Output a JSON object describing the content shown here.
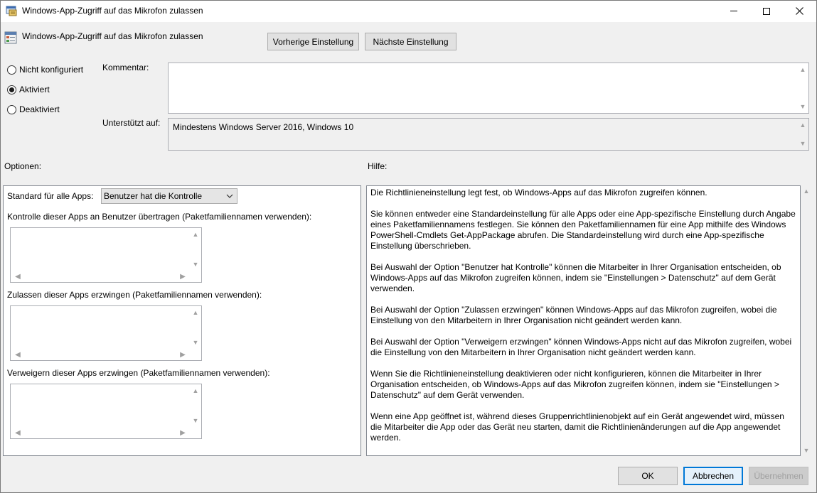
{
  "window": {
    "title": "Windows-App-Zugriff auf das Mikrofon zulassen",
    "minimize_glyph": "—",
    "maximize_glyph": "☐",
    "close_glyph": "✕"
  },
  "header": {
    "title": "Windows-App-Zugriff auf das Mikrofon zulassen",
    "prev_button": "Vorherige Einstellung",
    "next_button": "Nächste Einstellung"
  },
  "state": {
    "options": [
      {
        "label": "Nicht konfiguriert",
        "selected": false
      },
      {
        "label": "Aktiviert",
        "selected": true
      },
      {
        "label": "Deaktiviert",
        "selected": false
      }
    ]
  },
  "comment": {
    "label": "Kommentar:",
    "value": ""
  },
  "supported": {
    "label": "Unterstützt auf:",
    "value": "Mindestens Windows Server 2016, Windows 10"
  },
  "options_section": {
    "heading": "Optionen:",
    "default_label": "Standard für alle Apps:",
    "default_value": "Benutzer hat die Kontrolle",
    "list1_label": "Kontrolle dieser Apps an Benutzer übertragen (Paketfamiliennamen verwenden):",
    "list2_label": "Zulassen dieser Apps erzwingen (Paketfamiliennamen verwenden):",
    "list3_label": "Verweigern dieser Apps erzwingen (Paketfamiliennamen verwenden):"
  },
  "help_section": {
    "heading": "Hilfe:",
    "paragraphs": [
      "Die Richtlinieneinstellung legt fest, ob Windows-Apps auf das Mikrofon zugreifen können.",
      "Sie können entweder eine Standardeinstellung für alle Apps oder eine App-spezifische Einstellung durch Angabe eines Paketfamiliennamens festlegen. Sie können den Paketfamiliennamen für eine App mithilfe des Windows PowerShell-Cmdlets Get-AppPackage abrufen. Die Standardeinstellung wird durch eine App-spezifische Einstellung überschrieben.",
      "Bei Auswahl der Option \"Benutzer hat Kontrolle\" können die Mitarbeiter in Ihrer Organisation entscheiden, ob Windows-Apps auf das Mikrofon zugreifen können, indem sie \"Einstellungen > Datenschutz\" auf dem Gerät verwenden.",
      "Bei Auswahl der Option \"Zulassen erzwingen\" können Windows-Apps auf das Mikrofon zugreifen, wobei die Einstellung von den Mitarbeitern in Ihrer Organisation nicht geändert werden kann.",
      "Bei Auswahl der Option \"Verweigern erzwingen\" können Windows-Apps nicht auf das Mikrofon zugreifen, wobei die Einstellung von den Mitarbeitern in Ihrer Organisation nicht geändert werden kann.",
      "Wenn Sie die Richtlinieneinstellung deaktivieren oder nicht konfigurieren, können die Mitarbeiter in Ihrer Organisation entscheiden, ob Windows-Apps auf das Mikrofon zugreifen können, indem sie \"Einstellungen > Datenschutz\" auf dem Gerät verwenden.",
      "Wenn eine App geöffnet ist, während dieses Gruppenrichtlinienobjekt auf ein Gerät angewendet wird, müssen die Mitarbeiter die App oder das Gerät neu starten, damit die Richtlinienänderungen auf die App angewendet werden."
    ]
  },
  "footer": {
    "ok": "OK",
    "cancel": "Abbrechen",
    "apply": "Übernehmen"
  },
  "icons": {
    "title_icon": "policy-settings-icon",
    "header_icon": "policy-window-icon",
    "scroll_up": "▲",
    "scroll_down": "▼",
    "scroll_left": "◀",
    "scroll_right": "▶"
  },
  "colors": {
    "accent": "#0078d7",
    "dialog_bg": "#f0f0f0"
  }
}
